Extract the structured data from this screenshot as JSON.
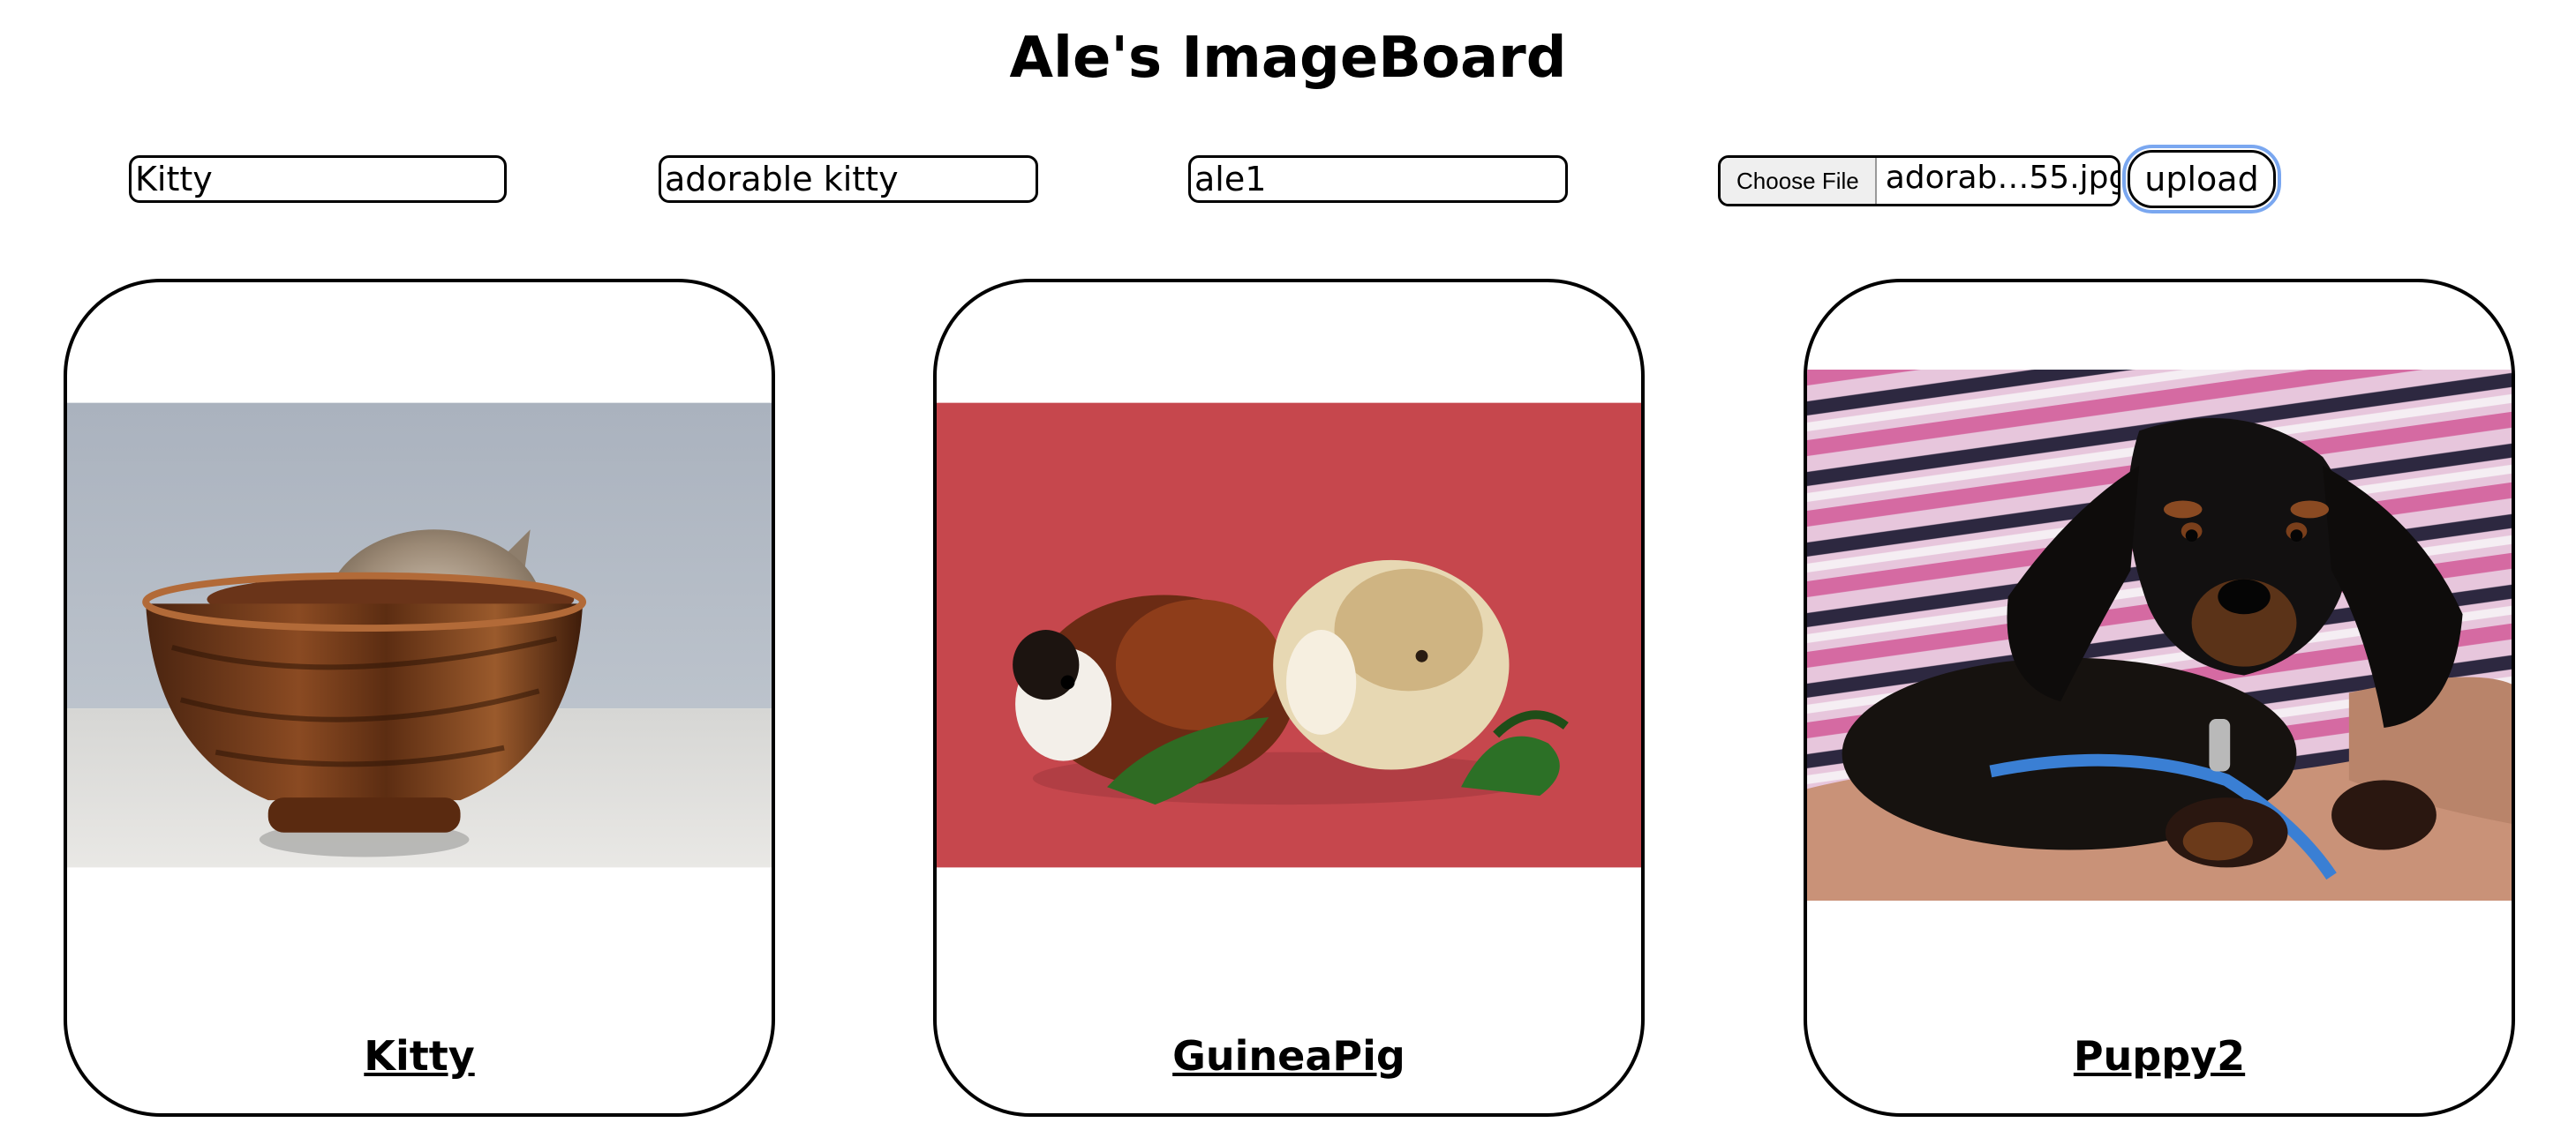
{
  "page": {
    "title": "Ale's ImageBoard"
  },
  "form": {
    "title_value": "Kitty",
    "description_value": "adorable kitty",
    "username_value": "ale1",
    "file_button_label": "Choose File",
    "file_name": "adorab…55.jpg",
    "upload_label": "upload"
  },
  "cards": [
    {
      "caption": "Kitty",
      "image": "kitten-in-wooden-bowl"
    },
    {
      "caption": "GuineaPig",
      "image": "two-guinea-pigs-on-red"
    },
    {
      "caption": "Puppy2",
      "image": "dachshund-puppy-in-arms"
    }
  ],
  "colors": {
    "focus_ring": "#7aa7f0"
  }
}
